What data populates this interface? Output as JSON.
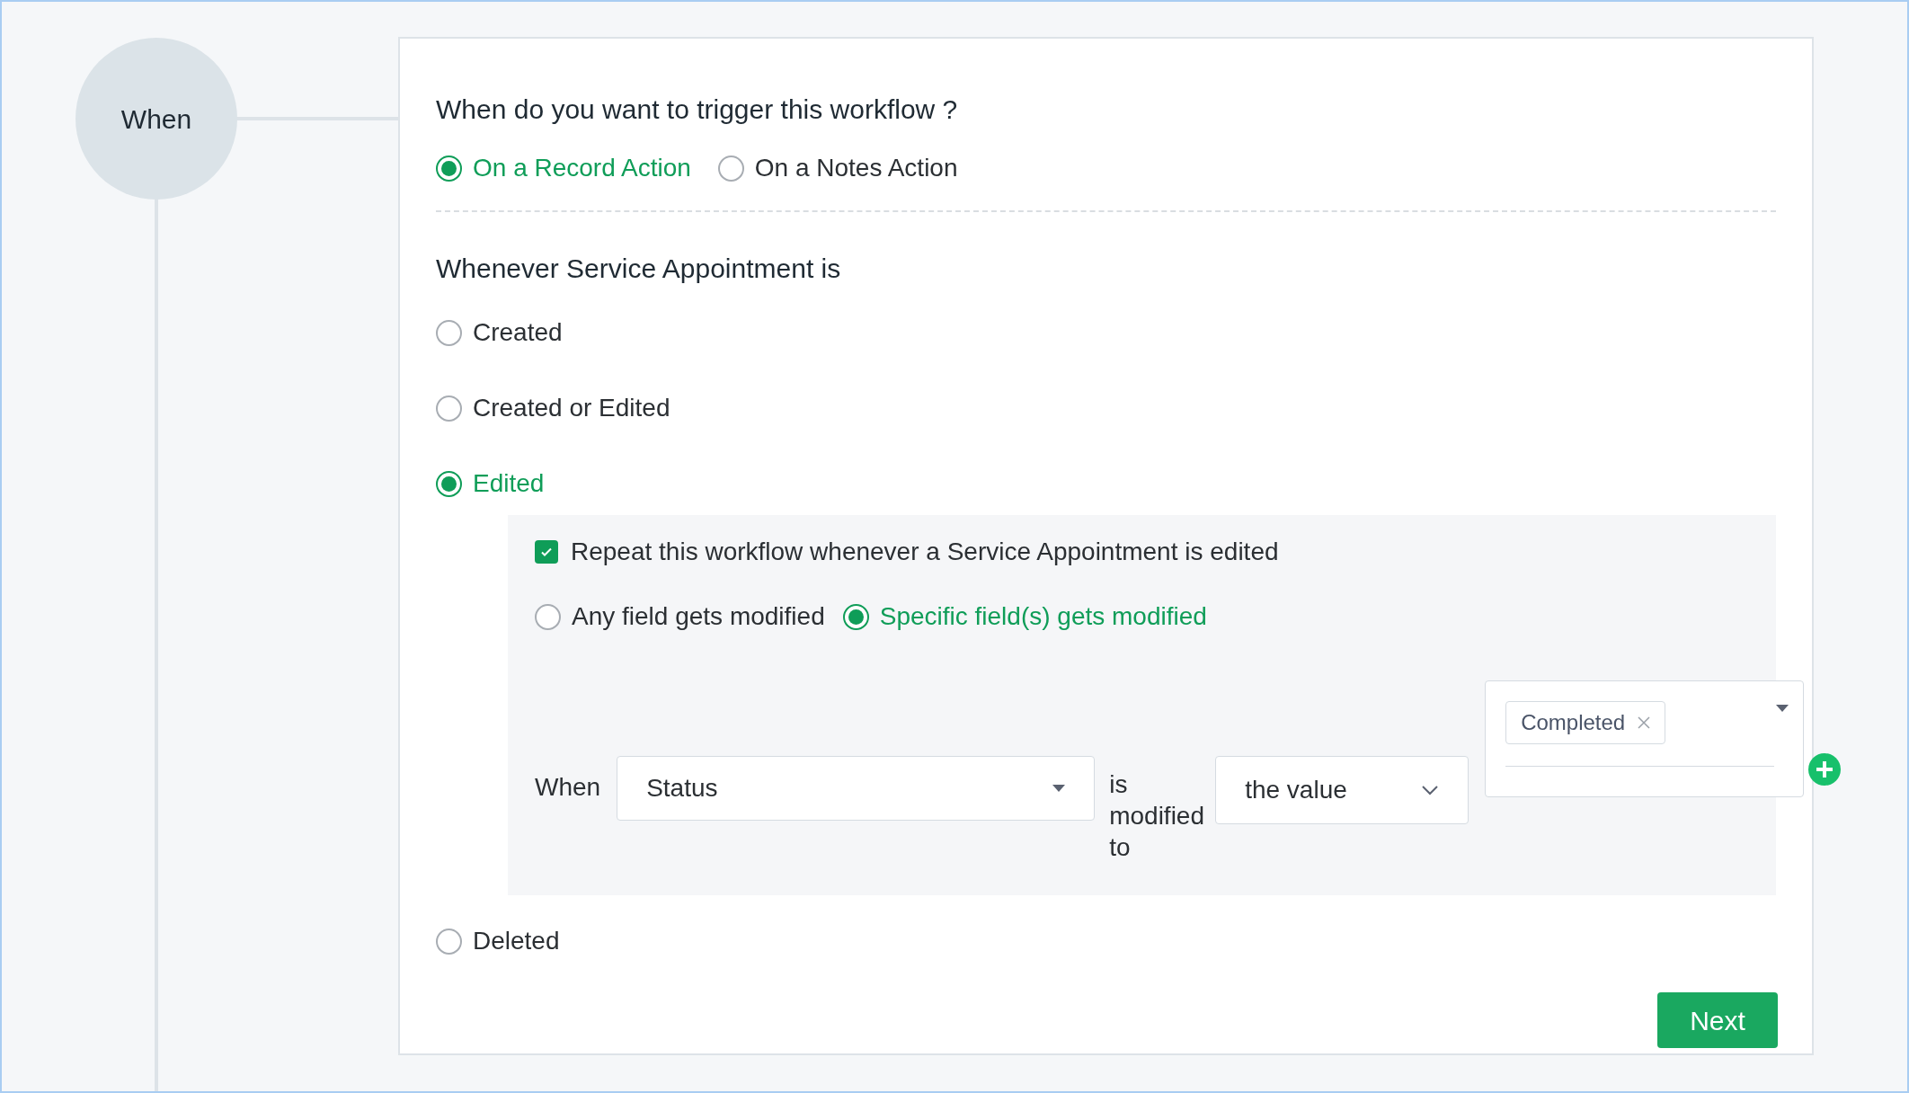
{
  "step": {
    "label": "When"
  },
  "trigger": {
    "question": "When do you want to trigger this workflow ?",
    "options": [
      {
        "label": "On a Record Action",
        "selected": true
      },
      {
        "label": "On a Notes Action",
        "selected": false
      }
    ]
  },
  "record_event": {
    "heading": "Whenever Service Appointment is",
    "options": [
      {
        "label": "Created",
        "selected": false
      },
      {
        "label": "Created or Edited",
        "selected": false
      },
      {
        "label": "Edited",
        "selected": true,
        "details": {
          "repeat": {
            "label": "Repeat this workflow whenever a Service Appointment is edited",
            "checked": true
          },
          "modify_options": [
            {
              "label": "Any field gets modified",
              "selected": false
            },
            {
              "label": "Specific field(s) gets modified",
              "selected": true
            }
          ],
          "condition": {
            "prefix": "When",
            "field": "Status",
            "operator": "is modified to",
            "mode": "the value",
            "values": [
              "Completed"
            ]
          }
        }
      },
      {
        "label": "Deleted",
        "selected": false
      }
    ]
  },
  "next_button": "Next"
}
